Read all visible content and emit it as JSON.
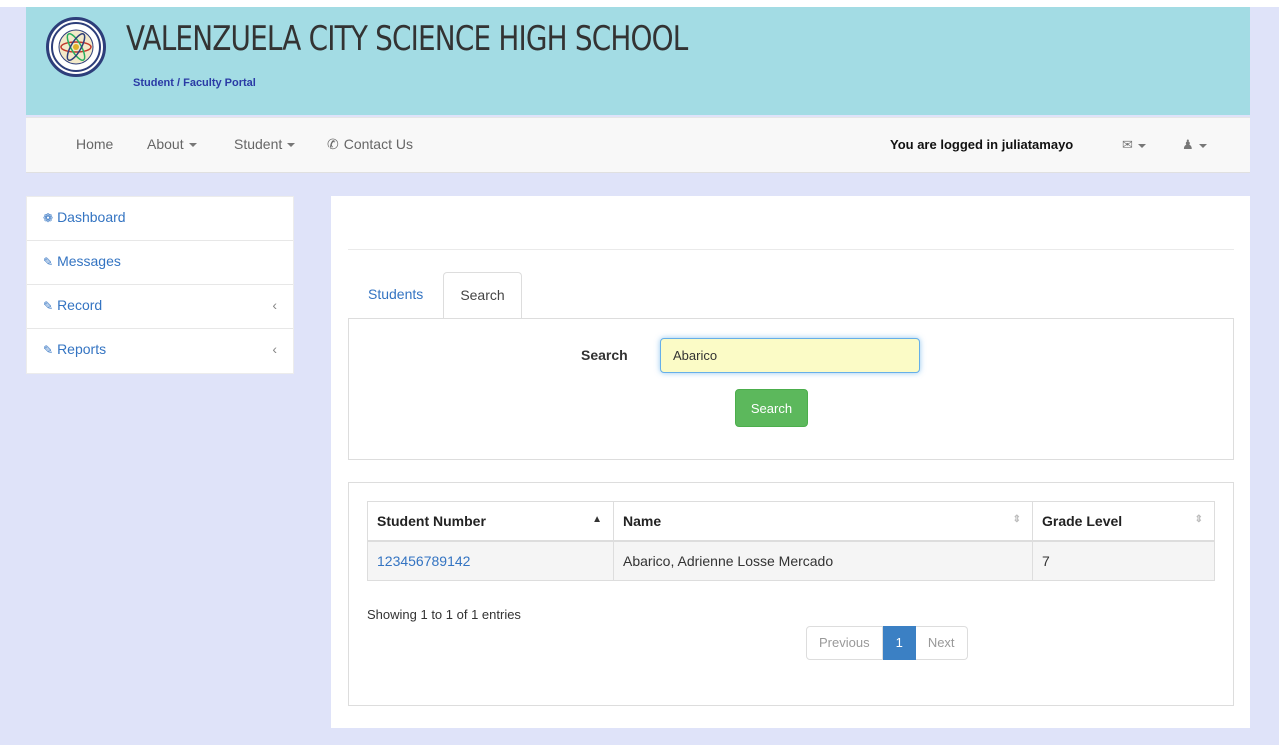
{
  "header": {
    "school_name": "VALENZUELA CITY SCIENCE HIGH SCHOOL",
    "portal_subtitle": "Student / Faculty Portal",
    "seal": "school-seal-logo",
    "colors": {
      "banner": "#a3dce4",
      "page_bg": "#dfe3f9",
      "accent": "#3474c2"
    }
  },
  "navbar": {
    "home": "Home",
    "about": "About",
    "student": "Student",
    "contact": "Contact Us",
    "logged_in_text": "You are logged in juliatamayo",
    "envelope_icon": "envelope-icon",
    "user_icon": "user-icon"
  },
  "sidebar": {
    "items": [
      {
        "label": "Dashboard",
        "icon": "dashboard-icon"
      },
      {
        "label": "Messages",
        "icon": "edit-icon"
      },
      {
        "label": "Record",
        "icon": "edit-icon"
      },
      {
        "label": "Reports",
        "icon": "edit-icon"
      }
    ]
  },
  "tabs": {
    "students": "Students",
    "search": "Search",
    "active": "Search"
  },
  "search": {
    "label": "Search",
    "value": "Abarico",
    "button": "Search"
  },
  "table": {
    "columns": [
      "Student Number",
      "Name",
      "Grade Level"
    ],
    "sorted_column": "Student Number",
    "rows": [
      {
        "student_number": "123456789142",
        "name": "Abarico, Adrienne Losse Mercado",
        "grade_level": "7"
      }
    ],
    "showing": "Showing 1 to 1 of 1 entries",
    "pagination": {
      "previous": "Previous",
      "page": "1",
      "next": "Next"
    }
  }
}
